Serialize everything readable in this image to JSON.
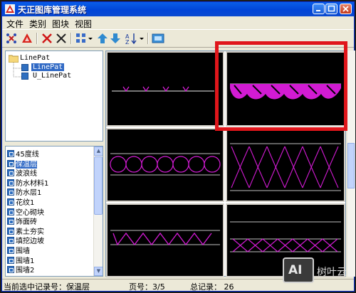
{
  "window": {
    "title": "天正图库管理系统"
  },
  "menu": [
    "文件",
    "类别",
    "图块",
    "视图"
  ],
  "tree": {
    "root": "LinePat",
    "children": [
      "LinePat",
      "U_LinePat"
    ]
  },
  "list": {
    "items": [
      "45度线",
      "保温层",
      "波浪线",
      "防水材料1",
      "防水层1",
      "花纹1",
      "空心砌块",
      "饰面砖",
      "素土夯实",
      "填挖边坡",
      "围墙",
      "围墙1",
      "围墙2"
    ],
    "selected_index": 1
  },
  "status": {
    "current": "当前选中记录号：保温层",
    "page": "页号：3/5",
    "total": "总记录： 26"
  },
  "watermark": {
    "logo": "AI",
    "text": "树叶云"
  },
  "colors": {
    "pattern": "#d21bd3",
    "line": "#bfbfbf",
    "highlight": "#e0161b"
  }
}
